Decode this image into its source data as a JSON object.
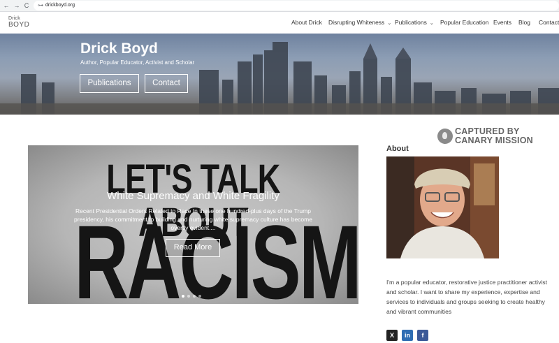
{
  "browser": {
    "url": "drickboyd.org",
    "back": "←",
    "forward": "→",
    "reload": "C",
    "site_icon": "⊶"
  },
  "header": {
    "logo_line1": "Drick",
    "logo_line2": "BOYD",
    "menu": [
      {
        "label": "About Drick",
        "dropdown": false
      },
      {
        "label": "Disrupting Whiteness",
        "dropdown": true
      },
      {
        "label": "Publications",
        "dropdown": true
      },
      {
        "label": "Popular Education",
        "dropdown": false
      },
      {
        "label": "Events",
        "dropdown": false
      },
      {
        "label": "Blog",
        "dropdown": false
      },
      {
        "label": "Contact",
        "dropdown": false
      }
    ]
  },
  "hero": {
    "title": "Drick Boyd",
    "subtitle": "Author, Popular Educator, Activist and Scholar",
    "buttons": [
      "Publications",
      "Contact"
    ]
  },
  "badge": {
    "line1": "CAPTURED BY",
    "line2": "CANARY MISSION"
  },
  "slider": {
    "image_text_1": "LET'S TALK ABOUT",
    "image_text_2": "RACISM",
    "title": "White Supremacy and White Fragility",
    "excerpt": "Recent Presidential Orders Related to Race In these one hundred-plus days of the Trump presidency, his commitment to building and nurturing white supremacy culture has become overtly evident....",
    "button": "Read More",
    "dot_count": 4,
    "active_dot": 0
  },
  "about": {
    "heading": "About",
    "text": "I'm a popular educator, restorative justice practitioner activist and scholar. I want to share my experience, expertise and services to individuals and groups seeking to create healthy and vibrant communities"
  },
  "social": [
    {
      "icon": "x-icon",
      "glyph": "X",
      "color": "#222222"
    },
    {
      "icon": "linkedin-icon",
      "glyph": "in",
      "color": "#2f6db3"
    },
    {
      "icon": "facebook-icon",
      "glyph": "f",
      "color": "#3b5998"
    }
  ]
}
